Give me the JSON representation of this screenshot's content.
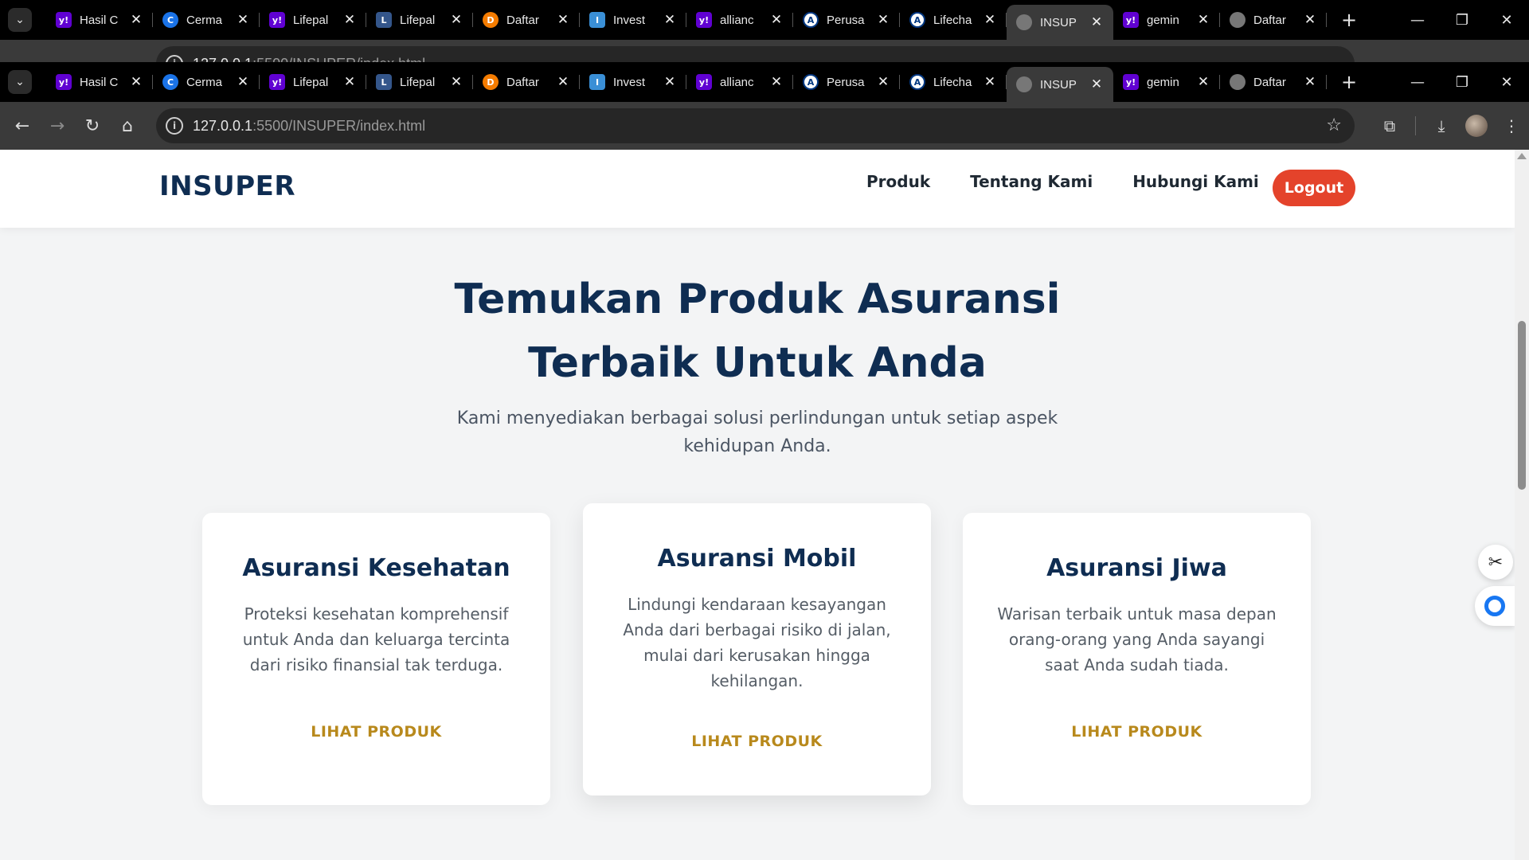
{
  "browser": {
    "tabs": [
      {
        "title": "Hasil C",
        "icon": "yahoo-icon",
        "favicon_text": "y!"
      },
      {
        "title": "Cerma",
        "icon": "c-icon",
        "favicon_text": "C"
      },
      {
        "title": "Lifepal",
        "icon": "yahoo-icon",
        "favicon_text": "y!"
      },
      {
        "title": "Lifepal",
        "icon": "lifepal-icon",
        "favicon_text": "L"
      },
      {
        "title": "Daftar",
        "icon": "daftar-icon",
        "favicon_text": "D"
      },
      {
        "title": "Invest",
        "icon": "invest-icon",
        "favicon_text": "I"
      },
      {
        "title": "allianc",
        "icon": "yahoo-icon",
        "favicon_text": "y!"
      },
      {
        "title": "Perusa",
        "icon": "allianz-icon",
        "favicon_text": "A"
      },
      {
        "title": "Lifecha",
        "icon": "allianz-icon",
        "favicon_text": "A"
      },
      {
        "title": "INSUP",
        "icon": "globe-icon",
        "favicon_text": ""
      },
      {
        "title": "gemin",
        "icon": "yahoo-icon",
        "favicon_text": "y!"
      },
      {
        "title": "Daftar",
        "icon": "globe-icon",
        "favicon_text": ""
      }
    ],
    "active_tab_index": 9,
    "url_host": "127.0.0.1",
    "url_path": ":5500/INSUPER/index.html"
  },
  "nav": {
    "logo": "INSUPER",
    "links": [
      "Produk",
      "Tentang Kami",
      "Hubungi Kami"
    ],
    "logout_label": "Logout"
  },
  "hero": {
    "title_line1": "Temukan Produk Asuransi",
    "title_line2": "Terbaik Untuk Anda",
    "subtitle": "Kami menyediakan berbagai solusi perlindungan untuk setiap aspek kehidupan Anda."
  },
  "cards": [
    {
      "title": "Asuransi Kesehatan",
      "description": "Proteksi kesehatan komprehensif untuk Anda dan keluarga tercinta dari risiko finansial tak terduga.",
      "link_label": "LIHAT PRODUK"
    },
    {
      "title": "Asuransi Mobil",
      "description": "Lindungi kendaraan kesayangan Anda dari berbagai risiko di jalan, mulai dari kerusakan hingga kehilangan.",
      "link_label": "LIHAT PRODUK"
    },
    {
      "title": "Asuransi Jiwa",
      "description": "Warisan terbaik untuk masa depan orang-orang yang Anda sayangi saat Anda sudah tiada.",
      "link_label": "LIHAT PRODUK"
    }
  ],
  "colors": {
    "brand_navy": "#0f2d52",
    "logout_red": "#e4432b",
    "link_gold": "#b8891c"
  }
}
